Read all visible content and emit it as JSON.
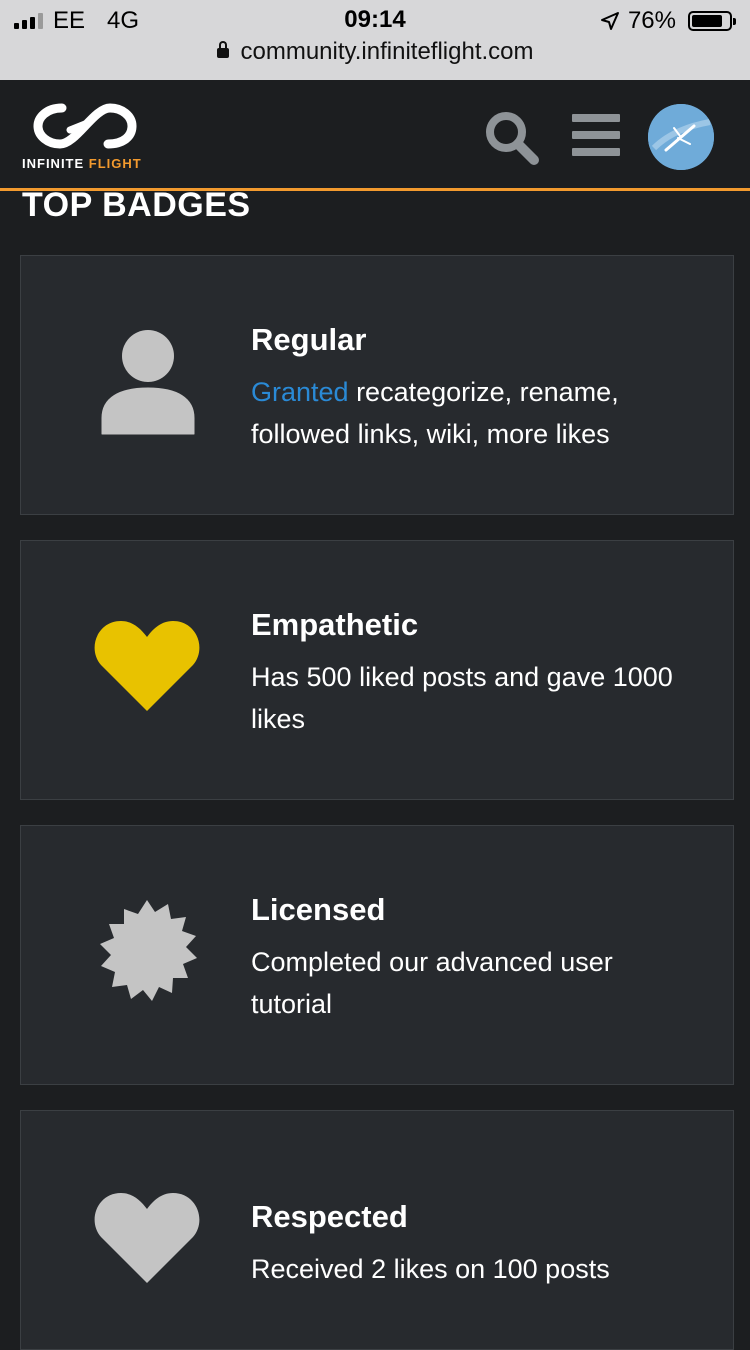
{
  "status_bar": {
    "carrier": "EE",
    "network": "4G",
    "time": "09:14",
    "battery": "76%",
    "battery_level": 0.76
  },
  "browser": {
    "url": "community.infiniteflight.com"
  },
  "header": {
    "logo_text_1": "INFINITE",
    "logo_text_2": "FLIGHT",
    "accent_color": "#f29a2e"
  },
  "section": {
    "title": "TOP BADGES"
  },
  "badges": [
    {
      "name": "Regular",
      "desc_link": "Granted",
      "description": " recategorize, rename, followed links, wiki, more likes",
      "icon": "user-icon",
      "color": "#c4c4c4"
    },
    {
      "name": "Empathetic",
      "description": "Has 500 liked posts and gave 1000 likes",
      "icon": "heart-icon",
      "color": "#e8c200"
    },
    {
      "name": "Licensed",
      "description": "Completed our advanced user tutorial",
      "icon": "certificate-icon",
      "color": "#c4c4c4"
    },
    {
      "name": "Respected",
      "description": "Received 2 likes on 100 posts",
      "icon": "heart-icon",
      "color": "#c4c4c4"
    }
  ]
}
